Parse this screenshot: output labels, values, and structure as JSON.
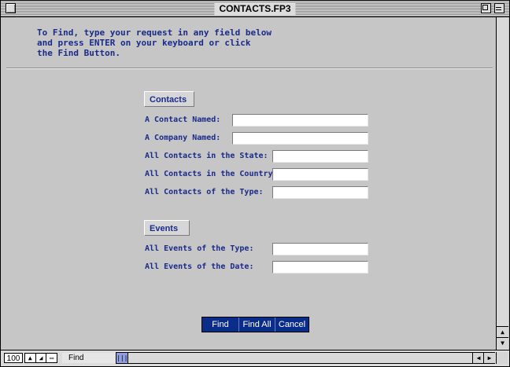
{
  "window": {
    "title": "CONTACTS.FP3"
  },
  "instructions": "To Find, type your request in any field below\nand press ENTER on your keyboard or click\nthe Find Button.",
  "contacts": {
    "header": "Contacts",
    "fields": [
      {
        "label": "A Contact Named:",
        "value": ""
      },
      {
        "label": "A Company Named:",
        "value": ""
      },
      {
        "label": "All Contacts in the State:",
        "value": ""
      },
      {
        "label": "All Contacts in the Country:",
        "value": ""
      },
      {
        "label": "All Contacts of the Type:",
        "value": ""
      }
    ]
  },
  "events": {
    "header": "Events",
    "fields": [
      {
        "label": "All Events of the Type:",
        "value": ""
      },
      {
        "label": "All Events of the Date:",
        "value": ""
      }
    ]
  },
  "buttons": {
    "find": "Find",
    "find_all": "Find All",
    "cancel": "Cancel"
  },
  "statusbar": {
    "zoom": "100",
    "mode": "Find"
  }
}
